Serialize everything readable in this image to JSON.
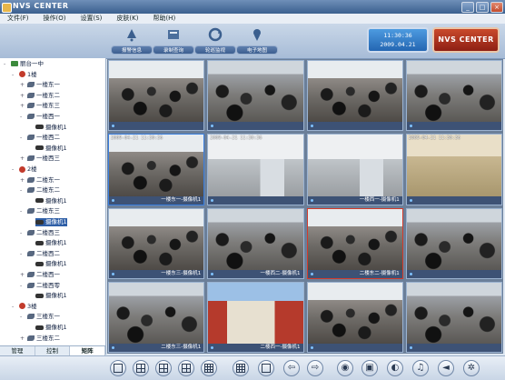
{
  "window": {
    "title": "NVS CENTER",
    "min_label": "_",
    "max_label": "□",
    "close_label": "×"
  },
  "menu": [
    {
      "label": "文件(F)"
    },
    {
      "label": "操作(O)"
    },
    {
      "label": "设置(S)"
    },
    {
      "label": "皮肤(K)"
    },
    {
      "label": "帮助(H)"
    }
  ],
  "toolbar": [
    {
      "label": "报警信息",
      "icon": "alarm-icon"
    },
    {
      "label": "录制查询",
      "icon": "record-query-icon"
    },
    {
      "label": "轮巡监视",
      "icon": "patrol-icon"
    },
    {
      "label": "电子地图",
      "icon": "e-map-icon"
    }
  ],
  "clock": {
    "time": "11:30:36",
    "date": "2009.04.21"
  },
  "brand": {
    "text": "NVS CENTER"
  },
  "tree": [
    {
      "label": "丽台一中",
      "type": "root",
      "level": 0,
      "expander": "-"
    },
    {
      "label": "1楼",
      "type": "floor",
      "level": 1,
      "expander": "-"
    },
    {
      "label": "一楼东一",
      "type": "room",
      "level": 2,
      "expander": "+"
    },
    {
      "label": "一楼东二",
      "type": "room",
      "level": 2,
      "expander": "+"
    },
    {
      "label": "一楼东三",
      "type": "room",
      "level": 2,
      "expander": "+"
    },
    {
      "label": "一楼西一",
      "type": "room",
      "level": 2,
      "expander": "-"
    },
    {
      "label": "摄像机1",
      "type": "camera",
      "level": 3,
      "expander": ""
    },
    {
      "label": "一楼西二",
      "type": "room",
      "level": 2,
      "expander": "-"
    },
    {
      "label": "摄像机1",
      "type": "camera",
      "level": 3,
      "expander": ""
    },
    {
      "label": "一楼西三",
      "type": "room",
      "level": 2,
      "expander": "+"
    },
    {
      "label": "2楼",
      "type": "floor",
      "level": 1,
      "expander": "-"
    },
    {
      "label": "二楼东一",
      "type": "room",
      "level": 2,
      "expander": "+"
    },
    {
      "label": "二楼东二",
      "type": "room",
      "level": 2,
      "expander": "-"
    },
    {
      "label": "摄像机1",
      "type": "camera",
      "level": 3,
      "expander": ""
    },
    {
      "label": "二楼东三",
      "type": "room",
      "level": 2,
      "expander": "-"
    },
    {
      "label": "摄像机1",
      "type": "camera",
      "level": 3,
      "expander": "",
      "selected": true
    },
    {
      "label": "二楼西三",
      "type": "room",
      "level": 2,
      "expander": "-"
    },
    {
      "label": "摄像机1",
      "type": "camera",
      "level": 3,
      "expander": ""
    },
    {
      "label": "二楼西二",
      "type": "room",
      "level": 2,
      "expander": "-"
    },
    {
      "label": "摄像机1",
      "type": "camera",
      "level": 3,
      "expander": ""
    },
    {
      "label": "二楼西一",
      "type": "room",
      "level": 2,
      "expander": "+"
    },
    {
      "label": "二楼西零",
      "type": "room",
      "level": 2,
      "expander": "-"
    },
    {
      "label": "摄像机1",
      "type": "camera",
      "level": 3,
      "expander": ""
    },
    {
      "label": "3楼",
      "type": "floor",
      "level": 1,
      "expander": "-"
    },
    {
      "label": "三楼东一",
      "type": "room",
      "level": 2,
      "expander": "-"
    },
    {
      "label": "摄像机1",
      "type": "camera",
      "level": 3,
      "expander": ""
    },
    {
      "label": "三楼东二",
      "type": "room",
      "level": 2,
      "expander": "+"
    }
  ],
  "side_tabs": [
    {
      "label": "管理"
    },
    {
      "label": "控制"
    },
    {
      "label": "矩阵",
      "active": true
    }
  ],
  "video_cells": [
    {
      "caption": "",
      "scene": "classroom",
      "stamp": ""
    },
    {
      "caption": "",
      "scene": "classroom2",
      "stamp": ""
    },
    {
      "caption": "",
      "scene": "classroom",
      "stamp": ""
    },
    {
      "caption": "",
      "scene": "classroom2",
      "stamp": ""
    },
    {
      "caption": "一楼东一-摄像机1",
      "scene": "classroom",
      "stamp": "2009-04-21 11:30:36",
      "border": "blue"
    },
    {
      "caption": "",
      "scene": "emptyroom",
      "stamp": "2009-04-21 11:30:36"
    },
    {
      "caption": "一楼西一-摄像机1",
      "scene": "emptyroom",
      "stamp": ""
    },
    {
      "caption": "",
      "scene": "emptyroom2",
      "stamp": "2009-04-21 11:30:36"
    },
    {
      "caption": "一楼东三-摄像机1",
      "scene": "classroom",
      "stamp": ""
    },
    {
      "caption": "一楼西二-摄像机1",
      "scene": "classroom2",
      "stamp": ""
    },
    {
      "caption": "二楼东二-摄像机1",
      "scene": "classroom",
      "stamp": "",
      "border": "red"
    },
    {
      "caption": "",
      "scene": "classroom2",
      "stamp": ""
    },
    {
      "caption": "二楼东三-摄像机1",
      "scene": "classroom2",
      "stamp": ""
    },
    {
      "caption": "二楼西一-摄像机1",
      "scene": "outdoor",
      "stamp": ""
    },
    {
      "caption": "",
      "scene": "classroom",
      "stamp": ""
    },
    {
      "caption": "",
      "scene": "classroom2",
      "stamp": ""
    }
  ],
  "bottom_buttons": [
    {
      "name": "layout-1-button",
      "icon": "g1"
    },
    {
      "name": "layout-4-button",
      "icon": "g4"
    },
    {
      "name": "layout-6-button",
      "icon": "g4"
    },
    {
      "name": "layout-8-button",
      "icon": "g4"
    },
    {
      "name": "layout-9-button",
      "icon": "g9"
    },
    {
      "name": "layout-16-button",
      "icon": "g9"
    },
    {
      "name": "fullscreen-button",
      "icon": "g1"
    },
    {
      "name": "prev-page-button",
      "icon": "arrow-left",
      "glyph": "⇦"
    },
    {
      "name": "next-page-button",
      "icon": "arrow-right",
      "glyph": "⇨"
    },
    {
      "name": "record-button",
      "icon": "record",
      "glyph": "◉"
    },
    {
      "name": "snapshot-button",
      "icon": "camera",
      "glyph": "▣"
    },
    {
      "name": "talk-button",
      "icon": "talk",
      "glyph": "◐"
    },
    {
      "name": "audio-button",
      "icon": "audio",
      "glyph": "♫"
    },
    {
      "name": "volume-button",
      "icon": "volume",
      "glyph": "◄"
    },
    {
      "name": "settings-button",
      "icon": "settings",
      "glyph": "✲"
    }
  ]
}
